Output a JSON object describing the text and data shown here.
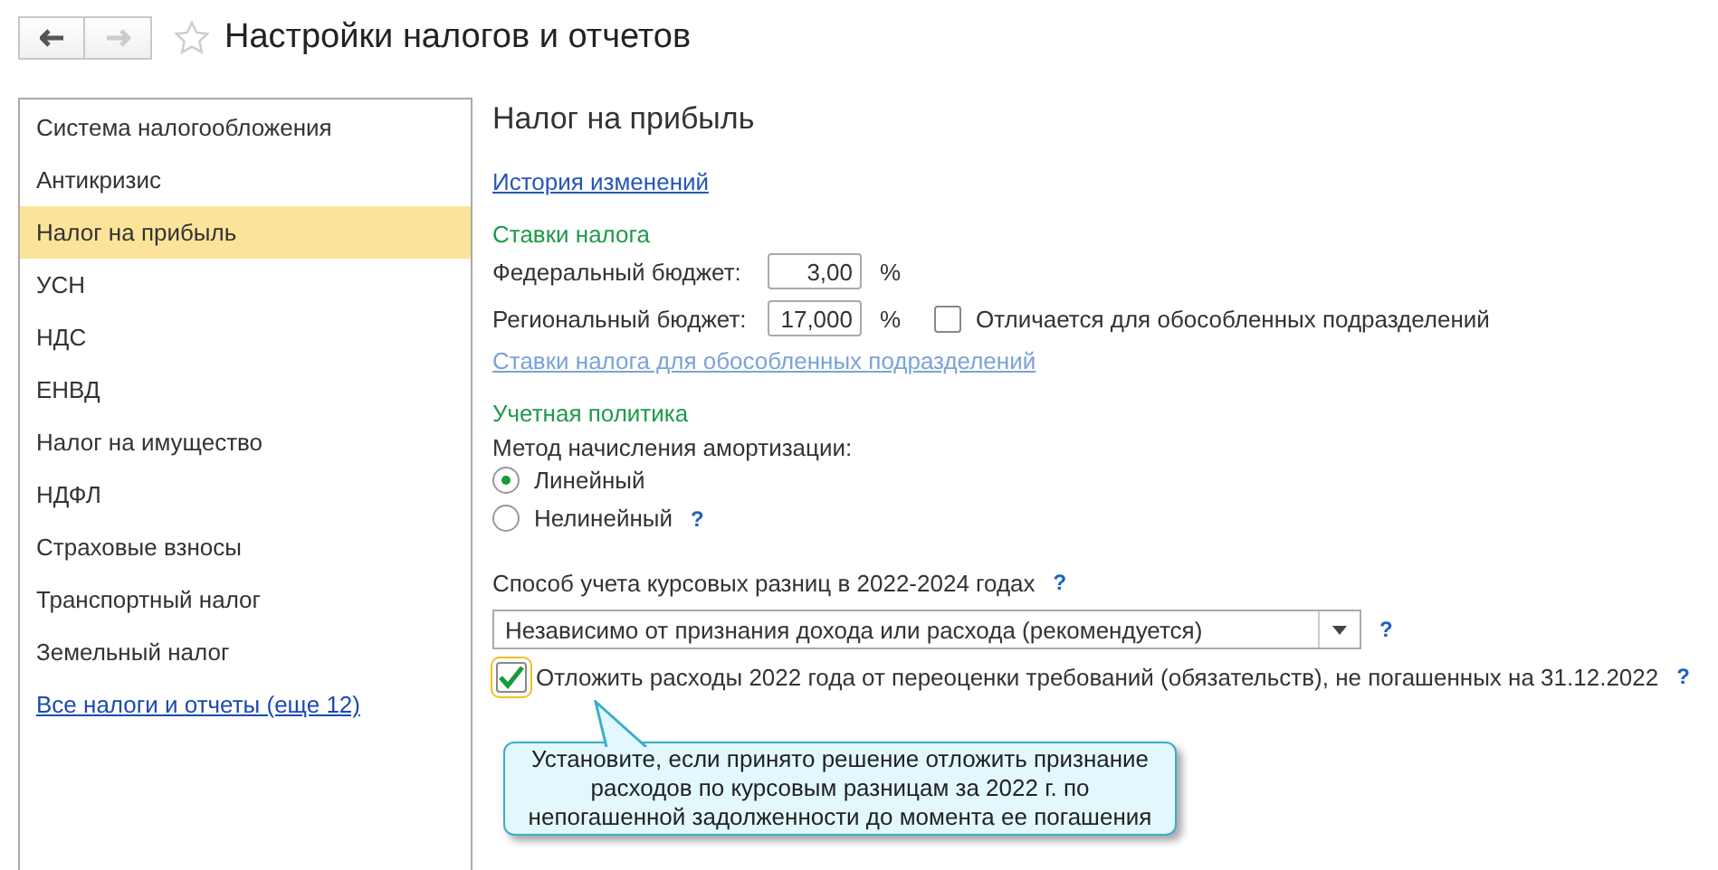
{
  "window": {
    "title": "Настройки налогов и отчетов",
    "favorite": false
  },
  "sidebar": {
    "items": [
      {
        "label": "Система налогообложения",
        "selected": false
      },
      {
        "label": "Антикризис",
        "selected": false
      },
      {
        "label": "Налог на прибыль",
        "selected": true
      },
      {
        "label": "УСН",
        "selected": false
      },
      {
        "label": "НДС",
        "selected": false
      },
      {
        "label": "ЕНВД",
        "selected": false
      },
      {
        "label": "Налог на имущество",
        "selected": false
      },
      {
        "label": "НДФЛ",
        "selected": false
      },
      {
        "label": "Страховые взносы",
        "selected": false
      },
      {
        "label": "Транспортный налог",
        "selected": false
      },
      {
        "label": "Земельный налог",
        "selected": false
      }
    ],
    "all_link": "Все налоги и отчеты (еще 12)"
  },
  "content": {
    "heading": "Налог на прибыль",
    "history_link": "История изменений",
    "rates": {
      "title": "Ставки налога",
      "federal": {
        "label": "Федеральный бюджет:",
        "value": "3,00",
        "unit": "%"
      },
      "regional": {
        "label": "Региональный бюджет:",
        "value": "17,000",
        "unit": "%"
      },
      "differs": {
        "label": "Отличается для обособленных подразделений",
        "checked": false
      },
      "subdivisions_link": "Ставки налога для обособленных подразделений"
    },
    "policy": {
      "title": "Учетная политика",
      "method_label": "Метод начисления амортизации:",
      "options": [
        {
          "label": "Линейный",
          "selected": true
        },
        {
          "label": "Нелинейный",
          "selected": false,
          "help": "?"
        }
      ]
    },
    "exchange": {
      "label": "Способ учета курсовых разниц в 2022-2024 годах",
      "help": "?",
      "value": "Независимо от признания дохода или расхода (рекомендуется)",
      "field_help": "?"
    },
    "defer": {
      "label": "Отложить расходы 2022 года от переоценки требований (обязательств), не погашенных на 31.12.2022",
      "checked": true,
      "help": "?"
    },
    "tooltip": "Установите, если принято решение отложить признание расходов по курсовым разницам за 2022 г. по непогашенной задолженности до момента ее погашения"
  }
}
